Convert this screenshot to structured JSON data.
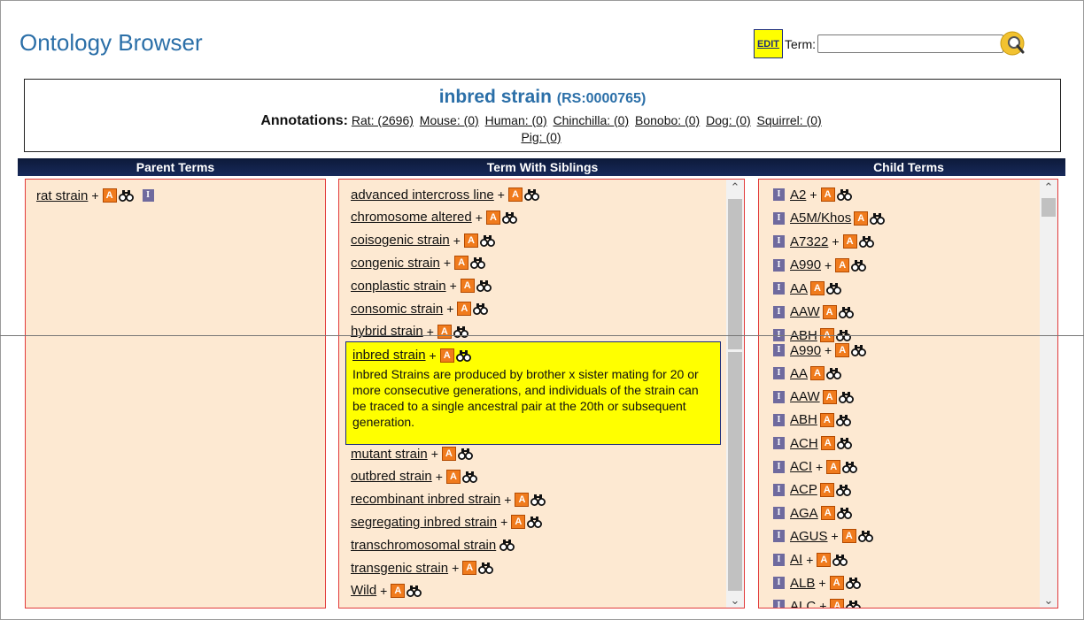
{
  "app": {
    "title": "Ontology Browser"
  },
  "search": {
    "edit_label": "EDIT",
    "term_label": "Term:",
    "placeholder": ""
  },
  "term": {
    "name": "inbred strain",
    "id": "(RS:0000765)",
    "annotations_label": "Annotations:",
    "annotations": [
      {
        "text": "Rat: (2696)"
      },
      {
        "text": "Mouse: (0)"
      },
      {
        "text": "Human: (0)"
      },
      {
        "text": "Chinchilla: (0)"
      },
      {
        "text": "Bonobo: (0)"
      },
      {
        "text": "Dog: (0)"
      },
      {
        "text": "Squirrel: (0)"
      },
      {
        "text": "Pig: (0)"
      }
    ]
  },
  "columns": {
    "parent": "Parent Terms",
    "siblings": "Term With Siblings",
    "children": "Child Terms"
  },
  "icons": {
    "annotation": "A",
    "info": "I"
  },
  "parent_terms": [
    {
      "label": "rat strain",
      "plus": "+"
    }
  ],
  "siblings_top": [
    {
      "label": "advanced intercross line",
      "plus": "+",
      "a": true
    },
    {
      "label": "chromosome altered",
      "plus": "+",
      "a": true
    },
    {
      "label": "coisogenic strain",
      "plus": "+",
      "a": true
    },
    {
      "label": "congenic strain",
      "plus": "+",
      "a": true
    },
    {
      "label": "conplastic strain",
      "plus": "+",
      "a": true
    },
    {
      "label": "consomic strain",
      "plus": "+",
      "a": true
    },
    {
      "label": "hybrid strain",
      "plus": "+",
      "a": true
    }
  ],
  "selected_sibling": {
    "label": "inbred strain",
    "plus": "+",
    "definition": "Inbred Strains are produced by brother x sister mating for 20 or more consecutive generations, and individuals of the strain can be traced to a single ancestral pair at the 20th or subsequent generation."
  },
  "siblings_bottom": [
    {
      "label": "mutant strain",
      "plus": "+",
      "a": true
    },
    {
      "label": "outbred strain",
      "plus": "+",
      "a": true
    },
    {
      "label": "recombinant inbred strain",
      "plus": "+",
      "a": true
    },
    {
      "label": "segregating inbred strain",
      "plus": "+",
      "a": true
    },
    {
      "label": "transchromosomal strain",
      "plus": "",
      "a": false
    },
    {
      "label": "transgenic strain",
      "plus": "+",
      "a": true
    },
    {
      "label": "Wild",
      "plus": "+",
      "a": true
    }
  ],
  "children_top": [
    {
      "label": "A2",
      "plus": "+"
    },
    {
      "label": "A5M/Khos",
      "plus": ""
    },
    {
      "label": "A7322",
      "plus": "+"
    },
    {
      "label": "A990",
      "plus": "+"
    },
    {
      "label": "AA",
      "plus": ""
    },
    {
      "label": "AAW",
      "plus": ""
    },
    {
      "label": "ABH",
      "plus": ""
    }
  ],
  "children_bottom": [
    {
      "label": "A990",
      "plus": "+"
    },
    {
      "label": "AA",
      "plus": ""
    },
    {
      "label": "AAW",
      "plus": ""
    },
    {
      "label": "ABH",
      "plus": ""
    },
    {
      "label": "ACH",
      "plus": ""
    },
    {
      "label": "ACI",
      "plus": "+"
    },
    {
      "label": "ACP",
      "plus": ""
    },
    {
      "label": "AGA",
      "plus": ""
    },
    {
      "label": "AGUS",
      "plus": "+"
    },
    {
      "label": "AI",
      "plus": "+"
    },
    {
      "label": "ALB",
      "plus": "+"
    },
    {
      "label": "ALC",
      "plus": "+"
    }
  ],
  "colors": {
    "title_blue": "#2b6fa8",
    "panel_bg": "#fde9d2",
    "panel_border": "#e23b3b",
    "header_bar": "#0d1a3a",
    "highlight": "#ffff00",
    "annotation_icon": "#f07b1d",
    "info_icon": "#6f6a9e"
  }
}
